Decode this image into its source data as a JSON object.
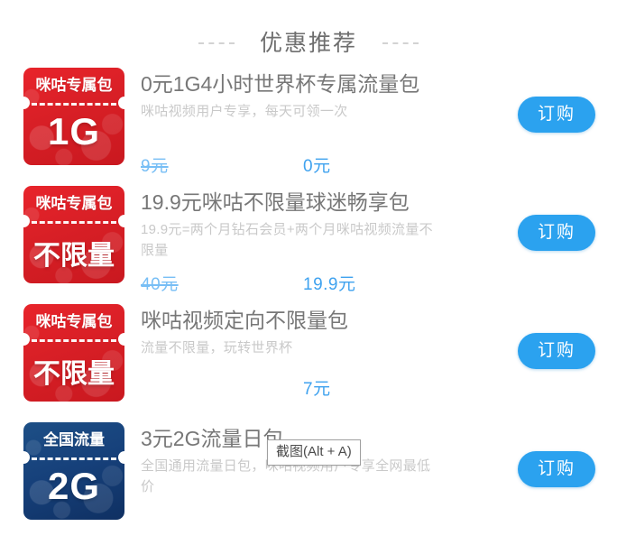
{
  "section": {
    "title": "优惠推荐",
    "left_rule": "dashed-rule",
    "right_rule": "dashed-rule"
  },
  "colors": {
    "accent_blue": "#2ba2ef",
    "price_new": "#3fa2ef",
    "price_old": "#77bef5",
    "title_text": "#777777",
    "desc_text": "#c9c9c9",
    "thumb_red": "#d81f26",
    "thumb_blue": "#16407a",
    "background": "#ffffff"
  },
  "offers": [
    {
      "thumb": {
        "style": "red",
        "top_label": "咪咕专属包",
        "big_label": "1G",
        "big_is_cjk": false
      },
      "title": "0元1G4小时世界杯专属流量包",
      "desc": "咪咕视频用户专享，每天可领一次",
      "price_old": "9元",
      "price_new": "0元",
      "button_label": "订购"
    },
    {
      "thumb": {
        "style": "red",
        "top_label": "咪咕专属包",
        "big_label": "不限量",
        "big_is_cjk": true
      },
      "title": "19.9元咪咕不限量球迷畅享包",
      "desc": "19.9元=两个月钻石会员+两个月咪咕视频流量不限量",
      "price_old": "40元",
      "price_new": "19.9元",
      "button_label": "订购"
    },
    {
      "thumb": {
        "style": "red",
        "top_label": "咪咕专属包",
        "big_label": "不限量",
        "big_is_cjk": true
      },
      "title": "咪咕视频定向不限量包",
      "desc": "流量不限量，玩转世界杯",
      "price_old": "",
      "price_new": "7元",
      "button_label": "订购"
    },
    {
      "thumb": {
        "style": "blue",
        "top_label": "全国流量",
        "big_label": "2G",
        "big_is_cjk": false
      },
      "title": "3元2G流量日包",
      "desc": "全国通用流量日包，咪咕视频用户专享全网最低价",
      "price_old": "",
      "price_new": "",
      "button_label": "订购"
    }
  ],
  "tooltip": {
    "label": "截图(Alt + A)"
  }
}
